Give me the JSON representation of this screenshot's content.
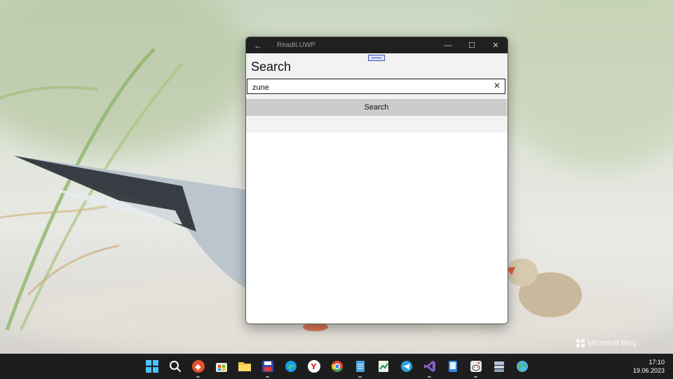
{
  "window": {
    "title": "Readit.UWP",
    "back_glyph": "←",
    "minimize_glyph": "—",
    "maximize_glyph": "☐",
    "close_glyph": "✕"
  },
  "page": {
    "title": "Search",
    "search_value": "zune",
    "clear_glyph": "✕",
    "search_button_label": "Search"
  },
  "wallpaper": {
    "watermark": "Microsoft Bing"
  },
  "taskbar": {
    "icons": [
      {
        "name": "start-icon",
        "color": "#3aa0ff"
      },
      {
        "name": "search-icon",
        "color": "#ffffff"
      },
      {
        "name": "anydesk-icon",
        "color": "#e8522e"
      },
      {
        "name": "microsoft-store-icon",
        "color": "#2b7de0"
      },
      {
        "name": "file-explorer-icon",
        "color": "#f4c542"
      },
      {
        "name": "save-app-icon",
        "color": "#3949ab"
      },
      {
        "name": "edge-icon",
        "color": "#1b9de2"
      },
      {
        "name": "yandex-browser-icon",
        "color": "#ffffff"
      },
      {
        "name": "chrome-icon",
        "color": "#34a853"
      },
      {
        "name": "notepad-icon",
        "color": "#4aa3df"
      },
      {
        "name": "spreadsheet-icon",
        "color": "#2e8b57"
      },
      {
        "name": "telegram-icon",
        "color": "#2aa3e0"
      },
      {
        "name": "visual-studio-icon",
        "color": "#7b4fc9"
      },
      {
        "name": "phone-app-icon",
        "color": "#2f8cf0"
      },
      {
        "name": "reddit-app-icon",
        "color": "#e0e0e0"
      },
      {
        "name": "storage-app-icon",
        "color": "#b0c4de"
      },
      {
        "name": "globe-app-icon",
        "color": "#4db6e8"
      }
    ],
    "time": "17:10",
    "date": "19.06.2023"
  }
}
